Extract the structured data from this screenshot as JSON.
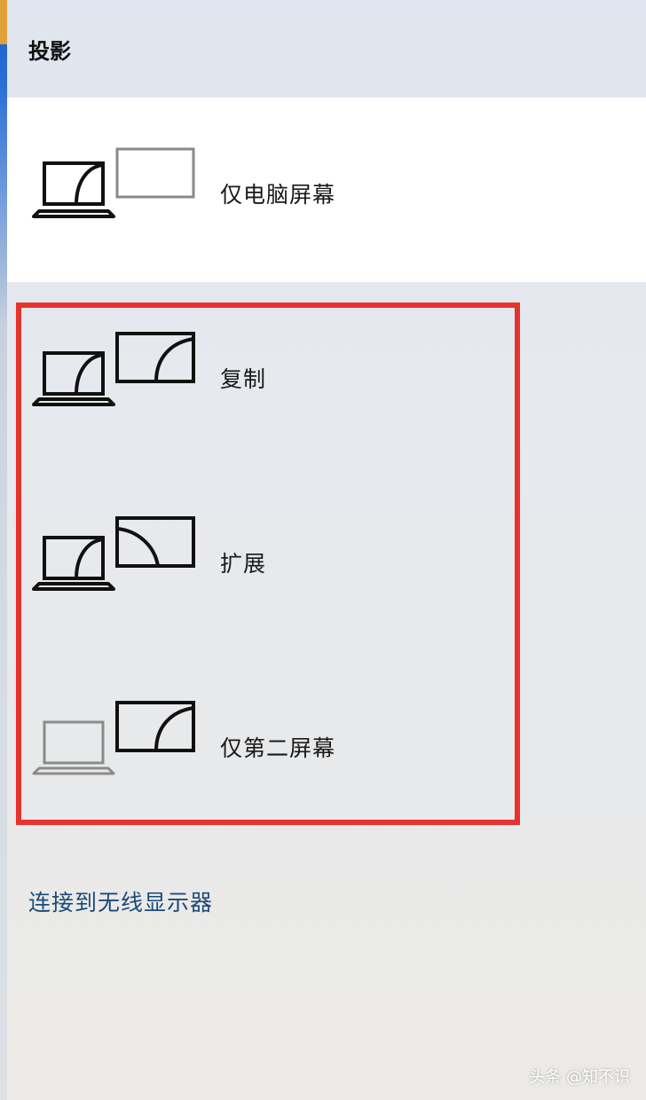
{
  "header": {
    "title": "投影"
  },
  "options": [
    {
      "label": "仅电脑屏幕",
      "icon": "pc-screen-only-icon",
      "selected": true
    },
    {
      "label": "复制",
      "icon": "duplicate-icon",
      "selected": false
    },
    {
      "label": "扩展",
      "icon": "extend-icon",
      "selected": false
    },
    {
      "label": "仅第二屏幕",
      "icon": "second-screen-only-icon",
      "selected": false
    }
  ],
  "wireless": {
    "label": "连接到无线显示器"
  },
  "watermark": {
    "text": "头条 @知不识"
  },
  "colors": {
    "highlight": "#e8322e",
    "link": "#1e4a78",
    "selected_background": "#ffffff",
    "inactive_icon": "#8a8a8a"
  }
}
